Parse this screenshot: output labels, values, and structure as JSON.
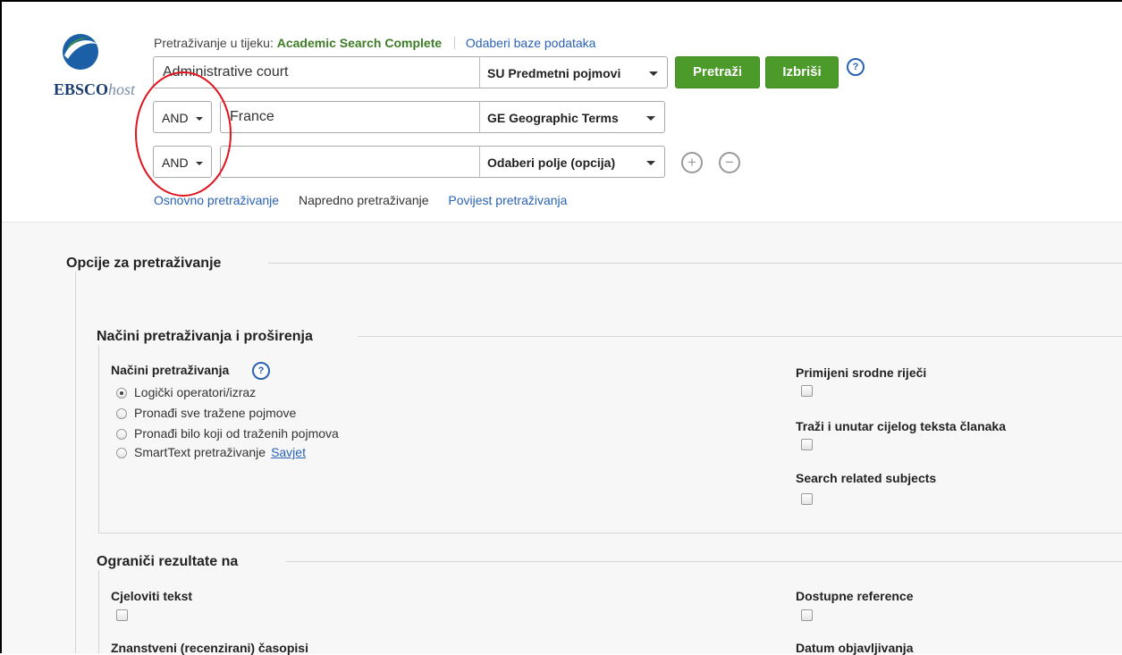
{
  "logo": {
    "brand": "EBSCO",
    "suffix": "host"
  },
  "search_context": {
    "prefix": "Pretraživanje u tijeku:",
    "database": "Academic Search Complete",
    "choose_db_link": "Odaberi baze podataka"
  },
  "search_rows": [
    {
      "operator": null,
      "term": "Administrative court",
      "field": "SU Predmetni pojmovi"
    },
    {
      "operator": "AND",
      "term": "France",
      "field": "GE Geographic Terms"
    },
    {
      "operator": "AND",
      "term": "",
      "field": "Odaberi polje (opcija)"
    }
  ],
  "buttons": {
    "search": "Pretraži",
    "clear": "Izbriši",
    "help": "?",
    "add_row": "+",
    "remove_row": "−"
  },
  "nav_links": {
    "basic": "Osnovno pretraživanje",
    "advanced": "Napredno pretraživanje",
    "history": "Povijest pretraživanja"
  },
  "options": {
    "title": "Opcije za pretraživanje",
    "modes_section": {
      "title": "Načini pretraživanja i proširenja",
      "modes_label": "Načini pretraživanja",
      "help": "?",
      "modes": [
        {
          "label": "Logički operatori/izraz",
          "checked": true
        },
        {
          "label": "Pronađi sve tražene pojmove",
          "checked": false
        },
        {
          "label": "Pronađi bilo koji od traženih pojmova",
          "checked": false
        },
        {
          "label": "SmartText pretraživanje",
          "checked": false
        }
      ],
      "tip_link": "Savjet",
      "expanders": [
        {
          "label": "Primijeni srodne riječi",
          "checked": false
        },
        {
          "label": "Traži i unutar cijelog teksta članaka",
          "checked": false
        },
        {
          "label": "Search related subjects",
          "checked": false
        }
      ]
    },
    "limits_section": {
      "title": "Ograniči rezultate na",
      "left": [
        {
          "label": "Cjeloviti tekst",
          "checked": false
        },
        {
          "label": "Znanstveni (recenzirani) časopisi"
        }
      ],
      "right": [
        {
          "label": "Dostupne reference",
          "checked": false
        },
        {
          "label": "Datum objavljivanja"
        }
      ]
    }
  },
  "colors": {
    "accent_green": "#4c9a2a",
    "link_blue": "#2a62b6",
    "annotation_red": "#e0141e",
    "database_green": "#3e7d27"
  }
}
